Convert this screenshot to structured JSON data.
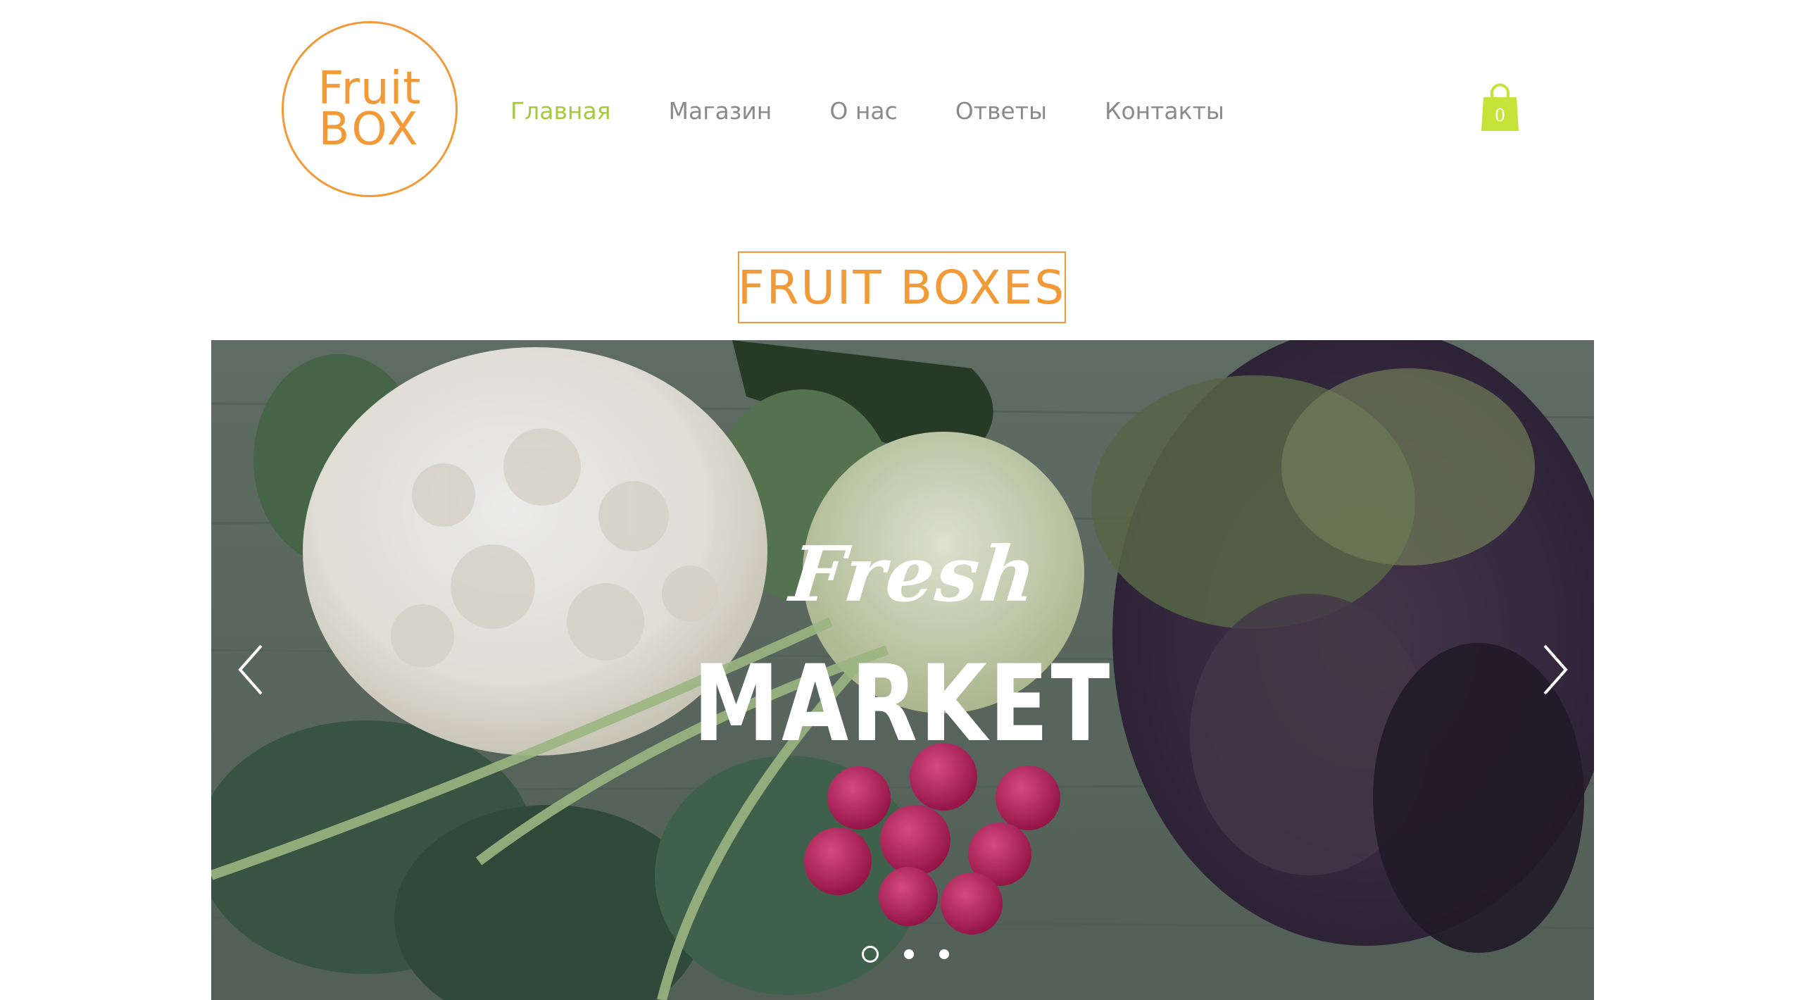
{
  "logo": {
    "line1": "Fruit",
    "line2": "BOX",
    "color": "#f29a38"
  },
  "nav": {
    "items": [
      {
        "label": "Главная",
        "active": true
      },
      {
        "label": "Магазин",
        "active": false
      },
      {
        "label": "О нас",
        "active": false
      },
      {
        "label": "Ответы",
        "active": false
      },
      {
        "label": "Контакты",
        "active": false
      }
    ],
    "active_color": "#a5c93a",
    "color": "#8a8a8a"
  },
  "cart": {
    "icon": "shopping-bag-icon",
    "count": "0",
    "color": "#c6e33a"
  },
  "heading": {
    "text": "FRUIT BOXES",
    "color": "#f29a38"
  },
  "slider": {
    "script_title": "Fresh",
    "main_title": "MARKET",
    "prev_icon": "chevron-left-icon",
    "next_icon": "chevron-right-icon",
    "slide_count": 3,
    "active_slide": 1
  }
}
